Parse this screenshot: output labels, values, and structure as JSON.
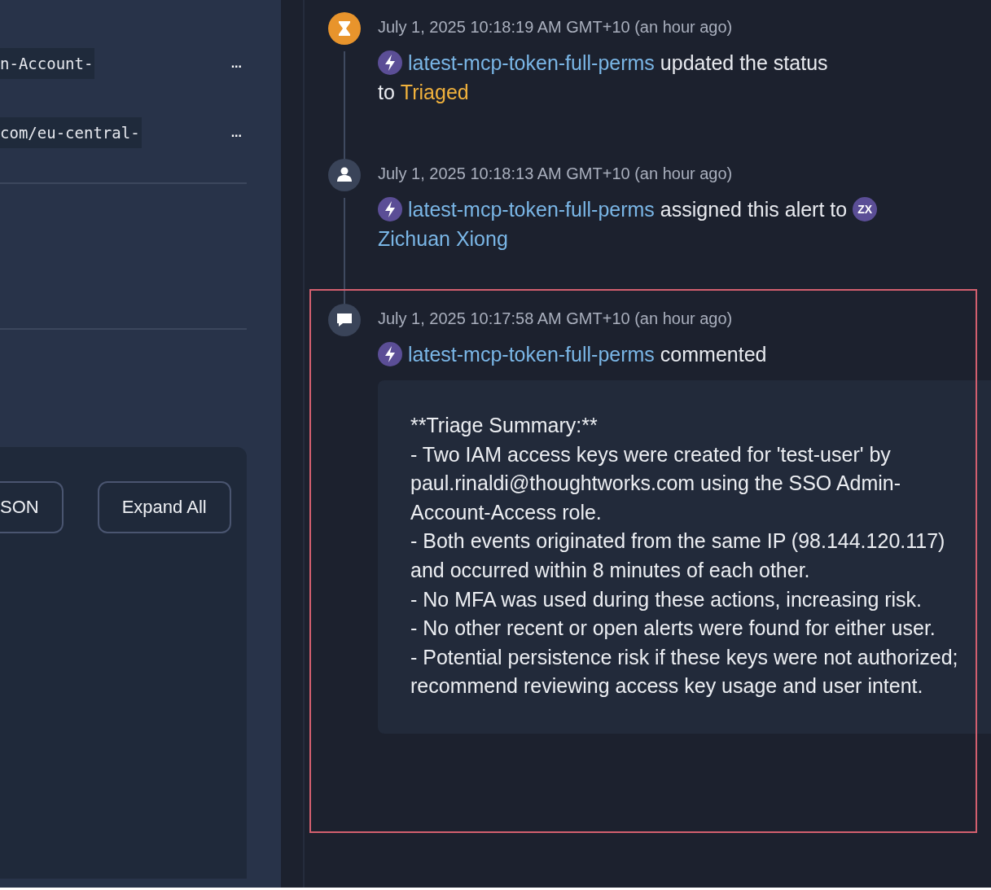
{
  "left_panel": {
    "code_lines": [
      {
        "text": "n-Account-",
        "more": "..."
      },
      {
        "text": "com/eu-central-",
        "more": "..."
      }
    ],
    "buttons": [
      "SON",
      "Expand All"
    ]
  },
  "timeline": [
    {
      "kind": "status",
      "time": "July 1, 2025 10:18:19 AM GMT+10 (an hour ago)",
      "actor": "latest-mcp-token-full-perms",
      "action": "updated the status",
      "line2_prefix": "to",
      "target": "Triaged",
      "highlighted": false
    },
    {
      "kind": "assign",
      "time": "July 1, 2025 10:18:13 AM GMT+10 (an hour ago)",
      "actor": "latest-mcp-token-full-perms",
      "action": "assigned this alert to",
      "avatar": "ZX",
      "target": "Zichuan Xiong",
      "highlighted": false
    },
    {
      "kind": "comment",
      "time": "July 1, 2025 10:17:58 AM GMT+10 (an hour ago)",
      "actor": "latest-mcp-token-full-perms",
      "action": "commented",
      "highlighted": true,
      "body": [
        "**Triage Summary:**",
        "- Two IAM access keys were created for 'test-user' by paul.rinaldi@thoughtworks.com using the SSO Admin-Account-Access role.",
        "- Both events originated from the same IP (98.144.120.117) and occurred within 8 minutes of each other.",
        "- No MFA was used during these actions, increasing risk.",
        "- No other recent or open alerts were found for either user.",
        "- Potential persistence risk if these keys were not authorized; recommend reviewing access key usage and user intent."
      ]
    }
  ]
}
